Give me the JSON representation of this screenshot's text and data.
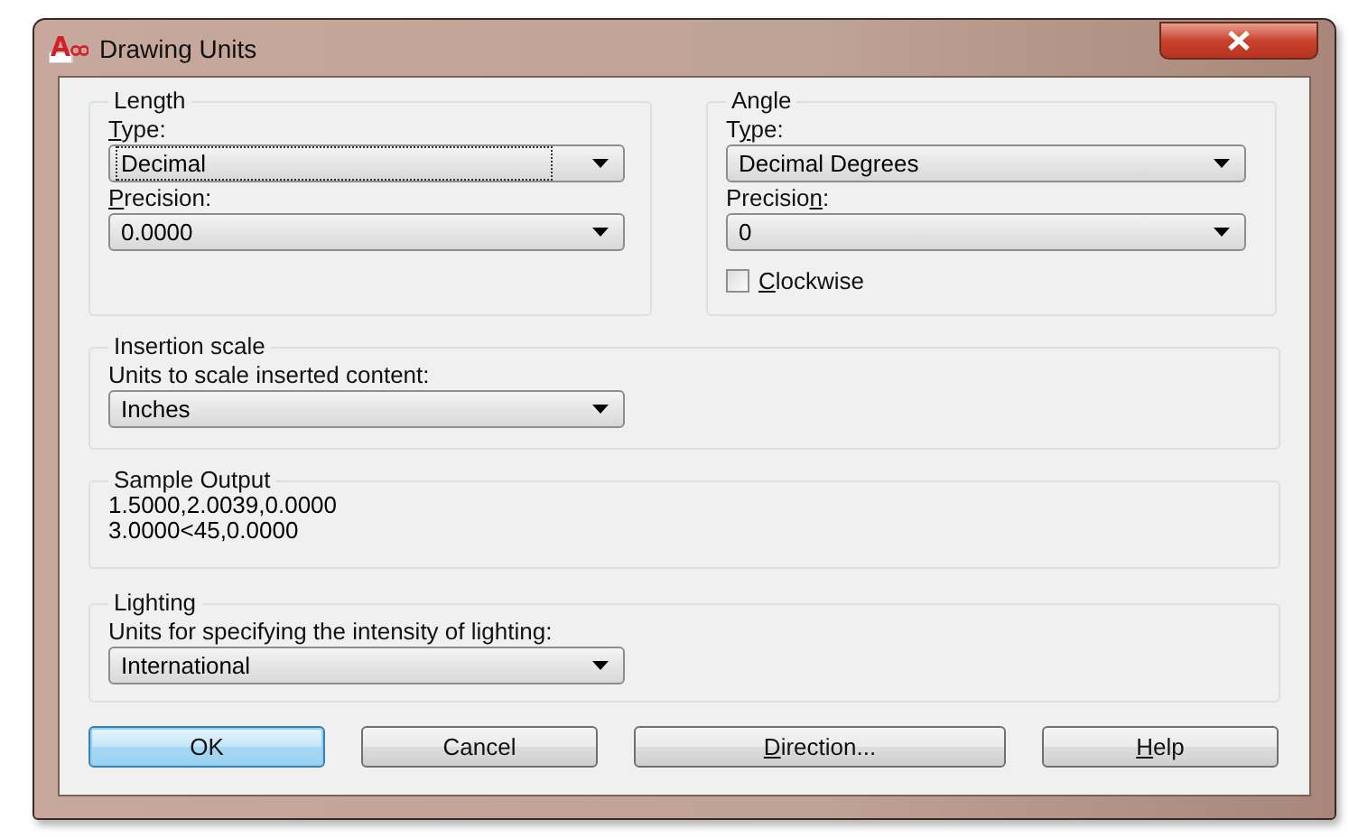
{
  "window": {
    "title": "Drawing Units"
  },
  "length": {
    "title": "Length",
    "fields": [
      {
        "label": [
          {
            "text": "T",
            "underline": true
          },
          {
            "text": "ype:",
            "underline": false
          }
        ],
        "value": "Decimal",
        "focused": true
      },
      {
        "label": [
          {
            "text": "P",
            "underline": true
          },
          {
            "text": "recision:",
            "underline": false
          }
        ],
        "value": "0.0000",
        "focused": false
      }
    ]
  },
  "angle": {
    "title": "Angle",
    "fields": [
      {
        "label": [
          {
            "text": "T",
            "underline": false
          },
          {
            "text": "y",
            "underline": true
          },
          {
            "text": "pe:",
            "underline": false
          }
        ],
        "value": "Decimal Degrees",
        "focused": false
      },
      {
        "label": [
          {
            "text": "Precisio",
            "underline": false
          },
          {
            "text": "n",
            "underline": true
          },
          {
            "text": ":",
            "underline": false
          }
        ],
        "value": "0",
        "focused": false
      }
    ],
    "clockwise": {
      "label": [
        {
          "text": "C",
          "underline": true
        },
        {
          "text": "lockwise",
          "underline": false
        }
      ],
      "checked": false
    }
  },
  "insertion_scale": {
    "title": "Insertion scale",
    "label": "Units to scale inserted content:",
    "value": "Inches"
  },
  "sample_output": {
    "title": "Sample Output",
    "lines": [
      "1.5000,2.0039,0.0000",
      "3.0000<45,0.0000"
    ]
  },
  "lighting": {
    "title": "Lighting",
    "label": "Units for specifying the intensity of lighting:",
    "value": "International"
  },
  "buttons": [
    {
      "label": [
        {
          "text": "OK",
          "underline": false
        }
      ],
      "default": true
    },
    {
      "label": [
        {
          "text": "Cancel",
          "underline": false
        }
      ],
      "default": false
    },
    {
      "label": [
        {
          "text": "D",
          "underline": true
        },
        {
          "text": "irection...",
          "underline": false
        }
      ],
      "default": false
    },
    {
      "label": [
        {
          "text": "H",
          "underline": true
        },
        {
          "text": "elp",
          "underline": false
        }
      ],
      "default": false
    }
  ]
}
